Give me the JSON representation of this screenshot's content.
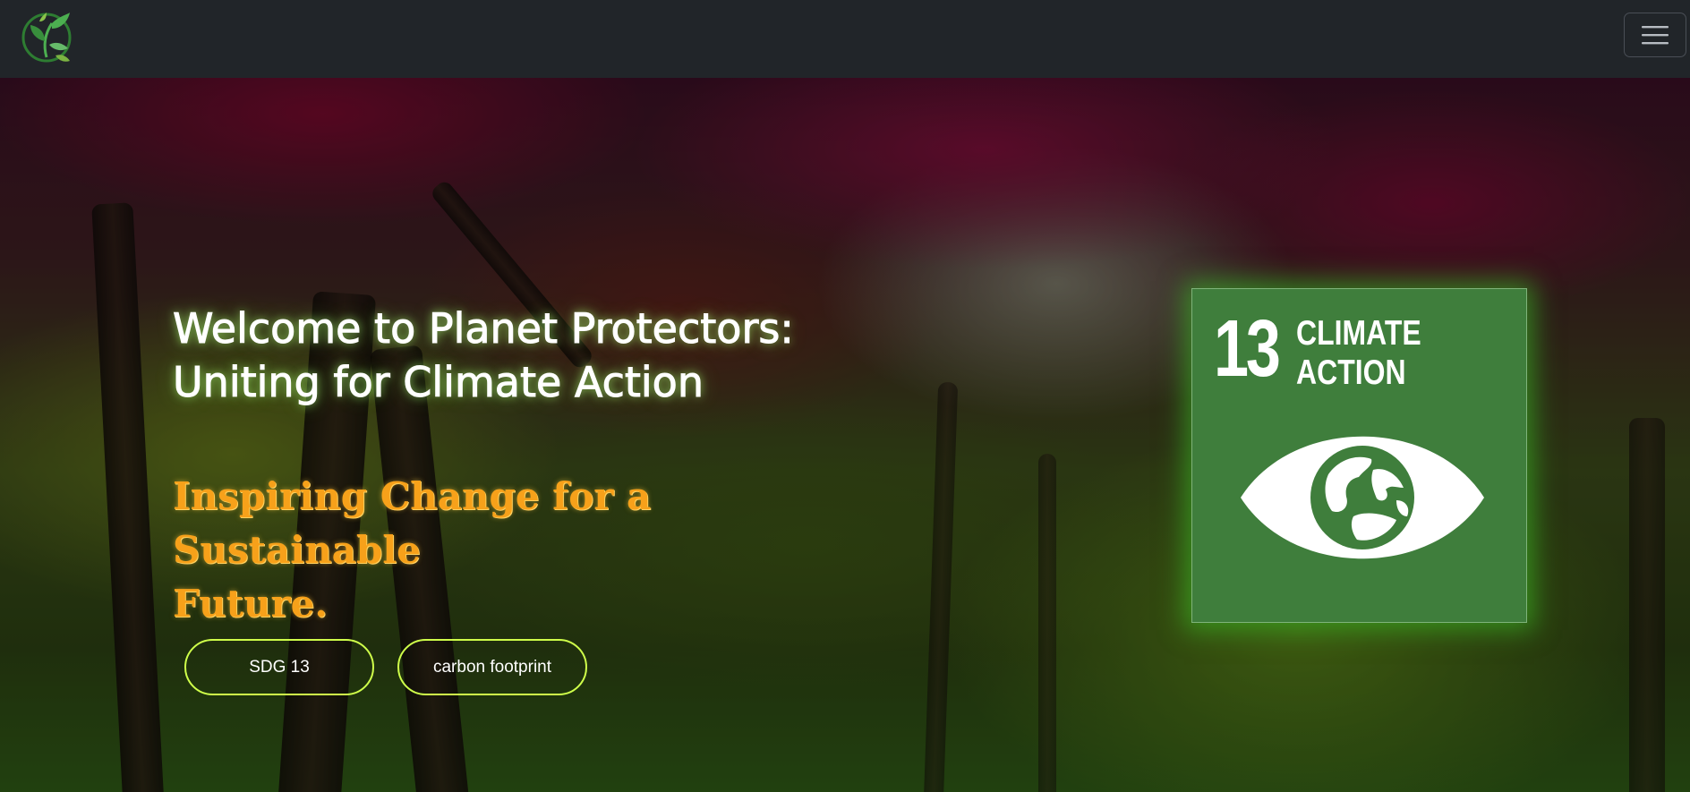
{
  "navbar": {
    "logo_icon": "leaf-globe-logo",
    "menu_icon": "hamburger-icon",
    "background": "#212529"
  },
  "hero": {
    "headline_line1": "Welcome to Planet Protectors:",
    "headline_line2": "Uniting for Climate Action",
    "tagline_line1": "Inspiring Change for a Sustainable",
    "tagline_line2": "Future.",
    "buttons": [
      {
        "label": "SDG 13"
      },
      {
        "label": "carbon footprint"
      }
    ],
    "accent_color": "#cfff4a",
    "tagline_color": "#f7a11a"
  },
  "sdg_card": {
    "number": "13",
    "title": "CLIMATE\nACTION",
    "icon": "eye-globe-icon",
    "background": "#3f7e3c"
  }
}
